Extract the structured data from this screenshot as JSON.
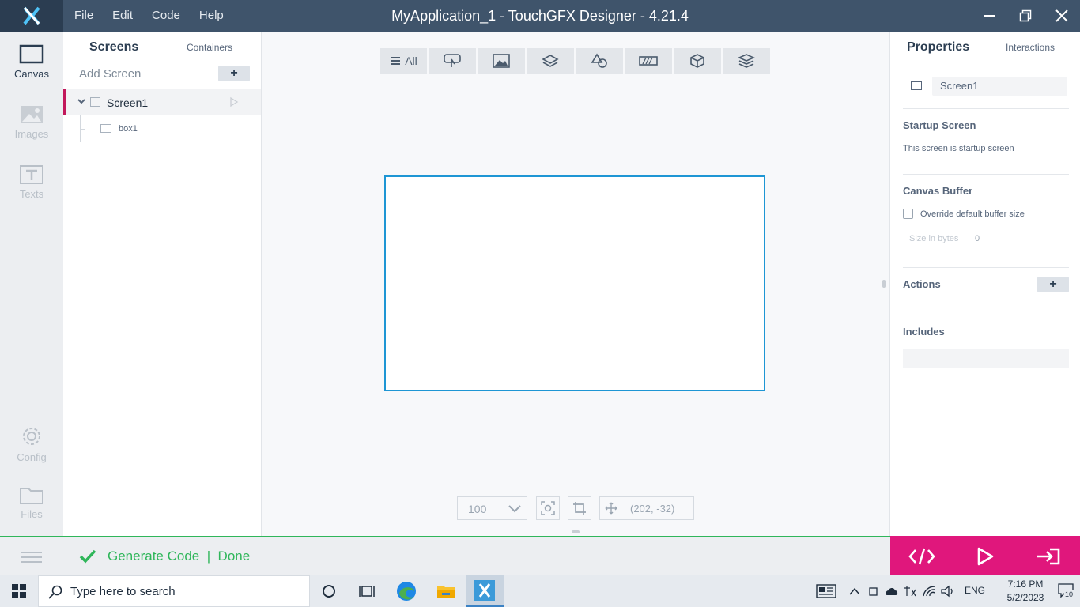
{
  "titlebar": {
    "menu": [
      "File",
      "Edit",
      "Code",
      "Help"
    ],
    "title": "MyApplication_1 - TouchGFX Designer - 4.21.4"
  },
  "rail": {
    "items": [
      {
        "label": "Canvas",
        "icon": "canvas-icon",
        "active": true
      },
      {
        "label": "Images",
        "icon": "image-icon",
        "active": false
      },
      {
        "label": "Texts",
        "icon": "text-icon",
        "active": false
      },
      {
        "label": "Config",
        "icon": "gear-icon",
        "active": false
      },
      {
        "label": "Files",
        "icon": "folder-icon",
        "active": false
      }
    ]
  },
  "screens_panel": {
    "tabs": [
      "Screens",
      "Containers"
    ],
    "add_screen_label": "Add Screen",
    "add_button": "+",
    "screens": [
      {
        "name": "Screen1",
        "widgets": [
          "box1"
        ]
      }
    ]
  },
  "widget_toolbar": {
    "all_label": "All",
    "groups": [
      "touch-icon",
      "image-icon",
      "layers-icon",
      "shapes-icon",
      "progress-icon",
      "cube-icon",
      "stack-icon"
    ]
  },
  "canvas_footer": {
    "zoom": "100",
    "coordinates": "(202, -32)"
  },
  "properties": {
    "tabs": [
      "Properties",
      "Interactions"
    ],
    "name_value": "Screen1",
    "startup_title": "Startup Screen",
    "startup_text": "This screen is startup screen",
    "buffer_title": "Canvas Buffer",
    "override_label": "Override default buffer size",
    "override_checked": false,
    "size_label": "Size in bytes",
    "size_value": "0",
    "actions_title": "Actions",
    "actions_add": "+",
    "includes_title": "Includes"
  },
  "statusbar": {
    "status_text": "Generate Code  |  Done",
    "status_color": "#2fb65a",
    "actions": [
      "code-icon",
      "play-icon",
      "export-icon"
    ],
    "accent": "#e0177c"
  },
  "taskbar": {
    "search_placeholder": "Type here to search",
    "language": "ENG",
    "time": "7:16 PM",
    "date": "5/2/2023",
    "notifications": "10"
  }
}
